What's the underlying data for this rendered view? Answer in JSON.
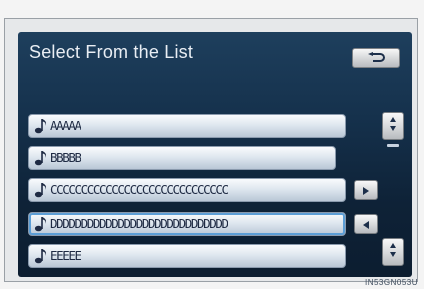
{
  "screen": {
    "title": "Select From the List",
    "back_icon": "return-arrow-icon",
    "image_code": "IN53GN053U"
  },
  "list": {
    "items": [
      {
        "label": "AAAAA",
        "icon": "music-note-icon",
        "arrow": null
      },
      {
        "label": "BBBBB",
        "icon": "music-note-icon",
        "arrow": null
      },
      {
        "label": "CCCCCCCCCCCCCCCCCCCCCCCCCCCCC",
        "icon": "music-note-icon",
        "arrow": "right"
      },
      {
        "label": "DDDDDDDDDDDDDDDDDDDDDDDDDDDDD",
        "icon": "music-note-icon",
        "arrow": "left"
      },
      {
        "label": "EEEEE",
        "icon": "music-note-icon",
        "arrow": null
      }
    ]
  },
  "scrollbar": {
    "up_icon": "scroll-up-icon",
    "down_icon": "scroll-down-icon"
  },
  "colors": {
    "screen_top": "#1e3f5d",
    "screen_bottom": "#0c1d30",
    "row_text": "#1e2a43",
    "title_text": "#e9eef4"
  }
}
